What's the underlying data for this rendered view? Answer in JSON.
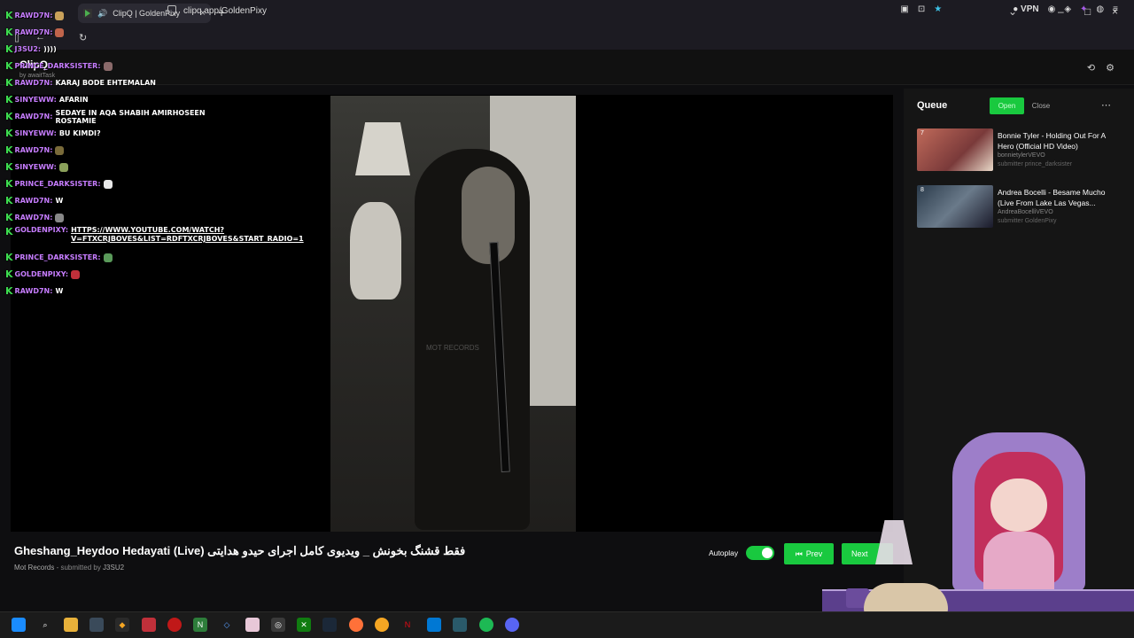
{
  "browser": {
    "tab_title": "ClipQ | GoldenPixy",
    "url": "clipq.app/GoldenPixy",
    "vpn_label": "VPN"
  },
  "app": {
    "logo": "ClipQ",
    "logo_sub": "by awaitTask"
  },
  "chat": [
    {
      "user": "RAWD7N:",
      "msg": "",
      "emote": "#c9a15a"
    },
    {
      "user": "RAWD7N:",
      "msg": "",
      "emote": "#c0644b"
    },
    {
      "user": "J3SU2:",
      "msg": "))))",
      "emote": ""
    },
    {
      "user": "PRINCE_DARKSISTER:",
      "msg": "",
      "emote": "#8a6a6a"
    },
    {
      "user": "RAWD7N:",
      "msg": "KARAJ BODE EHTEMALAN",
      "emote": ""
    },
    {
      "user": "SINYEWW:",
      "msg": "AFARIN",
      "emote": ""
    },
    {
      "user": "RAWD7N:",
      "msg": "SEDAYE IN AQA SHABIH AMIRHOSEEN ROSTAMIE",
      "emote": ""
    },
    {
      "user": "SINYEWW:",
      "msg": "BU KIMDI?",
      "emote": ""
    },
    {
      "user": "RAWD7N:",
      "msg": "",
      "emote": "#7a6b3a"
    },
    {
      "user": "SINYEWW:",
      "msg": "",
      "emote": "#8aa05a"
    },
    {
      "user": "PRINCE_DARKSISTER:",
      "msg": "",
      "emote": "#e8e8e8"
    },
    {
      "user": "RAWD7N:",
      "msg": "W",
      "emote": ""
    },
    {
      "user": "RAWD7N:",
      "msg": "",
      "emote": "#888888"
    },
    {
      "user": "GOLDENPIXY:",
      "msg": "HTTPS://WWW.YOUTUBE.COM/WATCH?V=FTXCRJBOVES&LIST=RDFTXCRJBOVES&START_RADIO=1",
      "emote": ""
    },
    {
      "user": "PRINCE_DARKSISTER:",
      "msg": "",
      "emote": "#5a9a5a"
    },
    {
      "user": "GOLDENPIXY:",
      "msg": "",
      "emote": "#c0303a"
    },
    {
      "user": "RAWD7N:",
      "msg": "W",
      "emote": ""
    }
  ],
  "video": {
    "watermark": "MOT RECORDS"
  },
  "queue": {
    "title": "Queue",
    "open_label": "Open",
    "close_label": "Close",
    "items": [
      {
        "num": "7",
        "title": "Bonnie Tyler - Holding Out For A Hero (Official HD Video)",
        "channel": "bonnietylerVEVO",
        "submitter": "submitter prince_darksister",
        "thumb_color": "#a65a4a"
      },
      {
        "num": "8",
        "title": "Andrea Bocelli - Besame Mucho (Live From Lake Las Vegas...",
        "channel": "AndreaBocelliVEVO",
        "submitter": "submitter GoldenPixy",
        "thumb_color": "#4a5a6a"
      }
    ]
  },
  "now_playing": {
    "title": "Gheshang_Heydoo Hedayati (Live) فقط قشنگ بخونش _ ویدیوی کامل اجرای حیدو هدایتی",
    "channel": "Mot Records",
    "submitted_by_label": " - submitted by ",
    "submitter": "J3SU2"
  },
  "controls": {
    "autoplay_label": "Autoplay",
    "autoplay_on": true,
    "prev_label": "Prev",
    "next_label": "Next"
  },
  "colors": {
    "accent": "#19c93f",
    "chat_user": "#c77dff",
    "kick_badge": "#3ddc4f"
  }
}
